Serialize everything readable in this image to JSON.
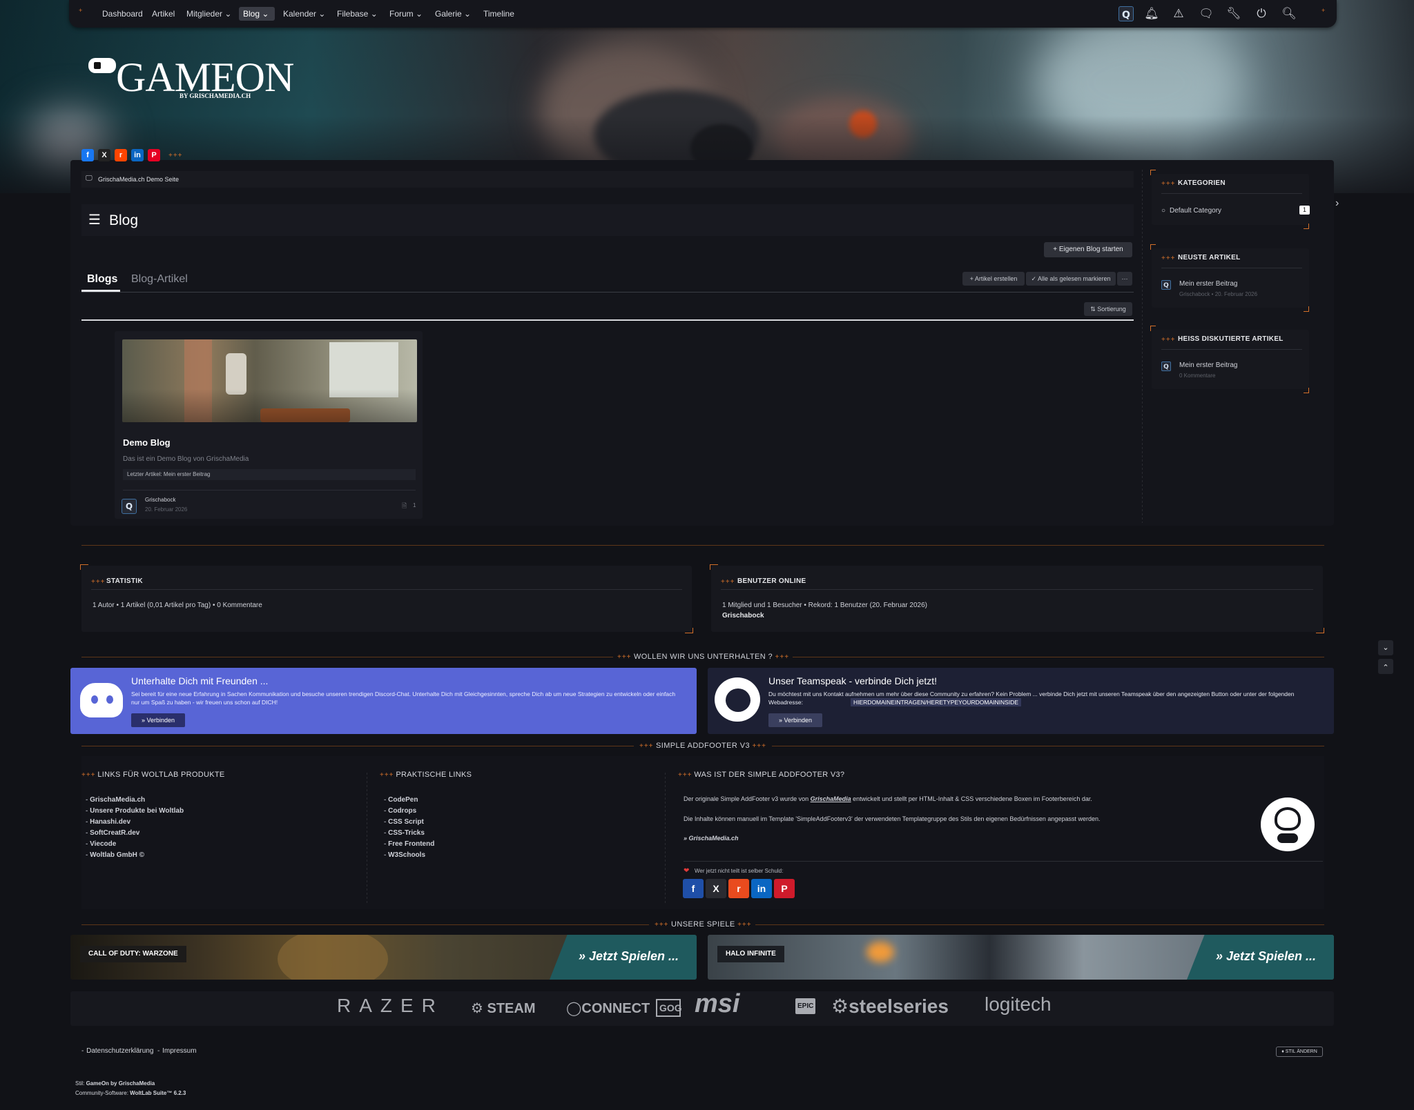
{
  "nav": {
    "items": [
      "Dashboard",
      "Artikel",
      "Mitglieder",
      "Blog",
      "Kalender",
      "Filebase",
      "Forum",
      "Galerie",
      "Timeline"
    ],
    "active": "Blog",
    "icons": [
      "user-avatar-icon",
      "bell-icon",
      "warning-icon",
      "chat-icon",
      "wrench-icon",
      "power-icon",
      "search-icon"
    ]
  },
  "logo": {
    "text_main": "GAMEON",
    "text_sub": "BY GRISCHAMEDIA.CH"
  },
  "breadcrumb": {
    "label": "GrischaMedia.ch Demo Seite"
  },
  "page": {
    "title": "Blog",
    "start_blog_button": "Eigenen Blog starten"
  },
  "tabs": {
    "blogs": "Blogs",
    "articles": "Blog-Artikel"
  },
  "toolbar": {
    "create_article": "Artikel erstellen",
    "mark_read": "Alle als gelesen markieren",
    "more": "···",
    "sort": "Sortierung"
  },
  "blog_card": {
    "title": "Demo Blog",
    "description": "Das ist ein Demo Blog von GrischaMedia",
    "last_article": "Letzter Artikel: Mein erster Beitrag",
    "author": "Grischabock",
    "date": "20. Februar 2026",
    "article_count": "1"
  },
  "sidebar": {
    "categories_title": "KATEGORIEN",
    "category": "Default Category",
    "category_count": "1",
    "latest_title": "NEUSTE ARTIKEL",
    "latest_article": "Mein erster Beitrag",
    "latest_meta": "Grischabock • 20. Februar 2026",
    "hot_title": "HEISS DISKUTIERTE ARTIKEL",
    "hot_article": "Mein erster Beitrag",
    "hot_meta": "0 Kommentare"
  },
  "stats": {
    "title": "STATISTIK",
    "text": "1 Autor • 1 Artikel (0,01 Artikel pro Tag) • 0 Kommentare"
  },
  "online": {
    "title": "BENUTZER ONLINE",
    "text": "1 Mitglied und 1 Besucher • Rekord: 1 Benutzer (20. Februar 2026)",
    "user": "Grischabock"
  },
  "chat_divider": "WOLLEN WIR UNS UNTERHALTEN ?",
  "discord": {
    "title": "Unterhalte Dich mit Freunden ...",
    "text": "Sei bereit für eine neue Erfahrung in Sachen Kommunikation und besuche unseren trendigen Discord-Chat. Unterhalte Dich mit Gleichgesinnten, spreche Dich ab um neue Strategien zu entwickeln oder einfach nur um Spaß zu haben - wir freuen uns schon auf DICH!",
    "button": "Verbinden"
  },
  "teamspeak": {
    "title": "Unser Teamspeak - verbinde Dich jetzt!",
    "text": "Du möchtest mit uns Kontakt aufnehmen um mehr über diese Community zu erfahren? Kein Problem ... verbinde Dich jetzt mit unseren Teamspeak über den angezeigten Button oder unter der folgenden Webadresse:",
    "address": "HIERDOMAINEINTRAGEN/HERETYPEYOURDOMAININSIDE",
    "button": "Verbinden"
  },
  "addfooter_divider": "SIMPLE ADDFOOTER V3",
  "footer_cols": {
    "col1_title": "LINKS FÜR WOLTLAB PRODUKTE",
    "col1_links": [
      "GrischaMedia.ch",
      "Unsere Produkte bei Woltlab",
      "Hanashi.dev",
      "SoftCreatR.dev",
      "Viecode",
      "Woltlab GmbH ©"
    ],
    "col2_title": "PRAKTISCHE LINKS",
    "col2_links": [
      "CodePen",
      "Codrops",
      "CSS Script",
      "CSS-Tricks",
      "Free Frontend",
      "W3Schools"
    ],
    "col3_title": "WAS IST DER SIMPLE ADDFOOTER V3?",
    "col3_p1_a": "Der originale Simple AddFooter v3 wurde von",
    "col3_p1_brand": "GrischaMedia",
    "col3_p1_b": "entwickelt und stellt per HTML-Inhalt & CSS verschiedene Boxen im Footerbereich dar.",
    "col3_p2": "Die Inhalte können manuell im Template 'SimpleAddFooterv3' der verwendeten Templategruppe des Stils den eigenen Bedürfnissen angepasst werden.",
    "col3_link": "» GrischaMedia.ch",
    "share_label": "Wer jetzt nicht teilt ist selber Schuld:"
  },
  "games_divider": "UNSERE SPIELE",
  "games": [
    {
      "name": "CALL OF DUTY: WARZONE",
      "cta": "Jetzt Spielen ..."
    },
    {
      "name": "HALO INFINITE",
      "cta": "Jetzt Spielen ..."
    }
  ],
  "brands": [
    "RAZER",
    "STEAM",
    "CONNECT",
    "GOG",
    "msi",
    "EPIC",
    "steelseries",
    "logitech"
  ],
  "bottom_links": [
    "Datenschutzerklärung",
    "Impressum"
  ],
  "style_button": "STIL ÄNDERN",
  "credits": {
    "style_label": "Stil:",
    "style_value": "GameOn by GrischaMedia",
    "software_label": "Community-Software:",
    "software_value": "WoltLab Suite™ 6.2.3"
  },
  "colors": {
    "accent": "#d4702a",
    "discord": "#5865d6",
    "teamspeak": "#1d2034",
    "background": "#111217"
  }
}
